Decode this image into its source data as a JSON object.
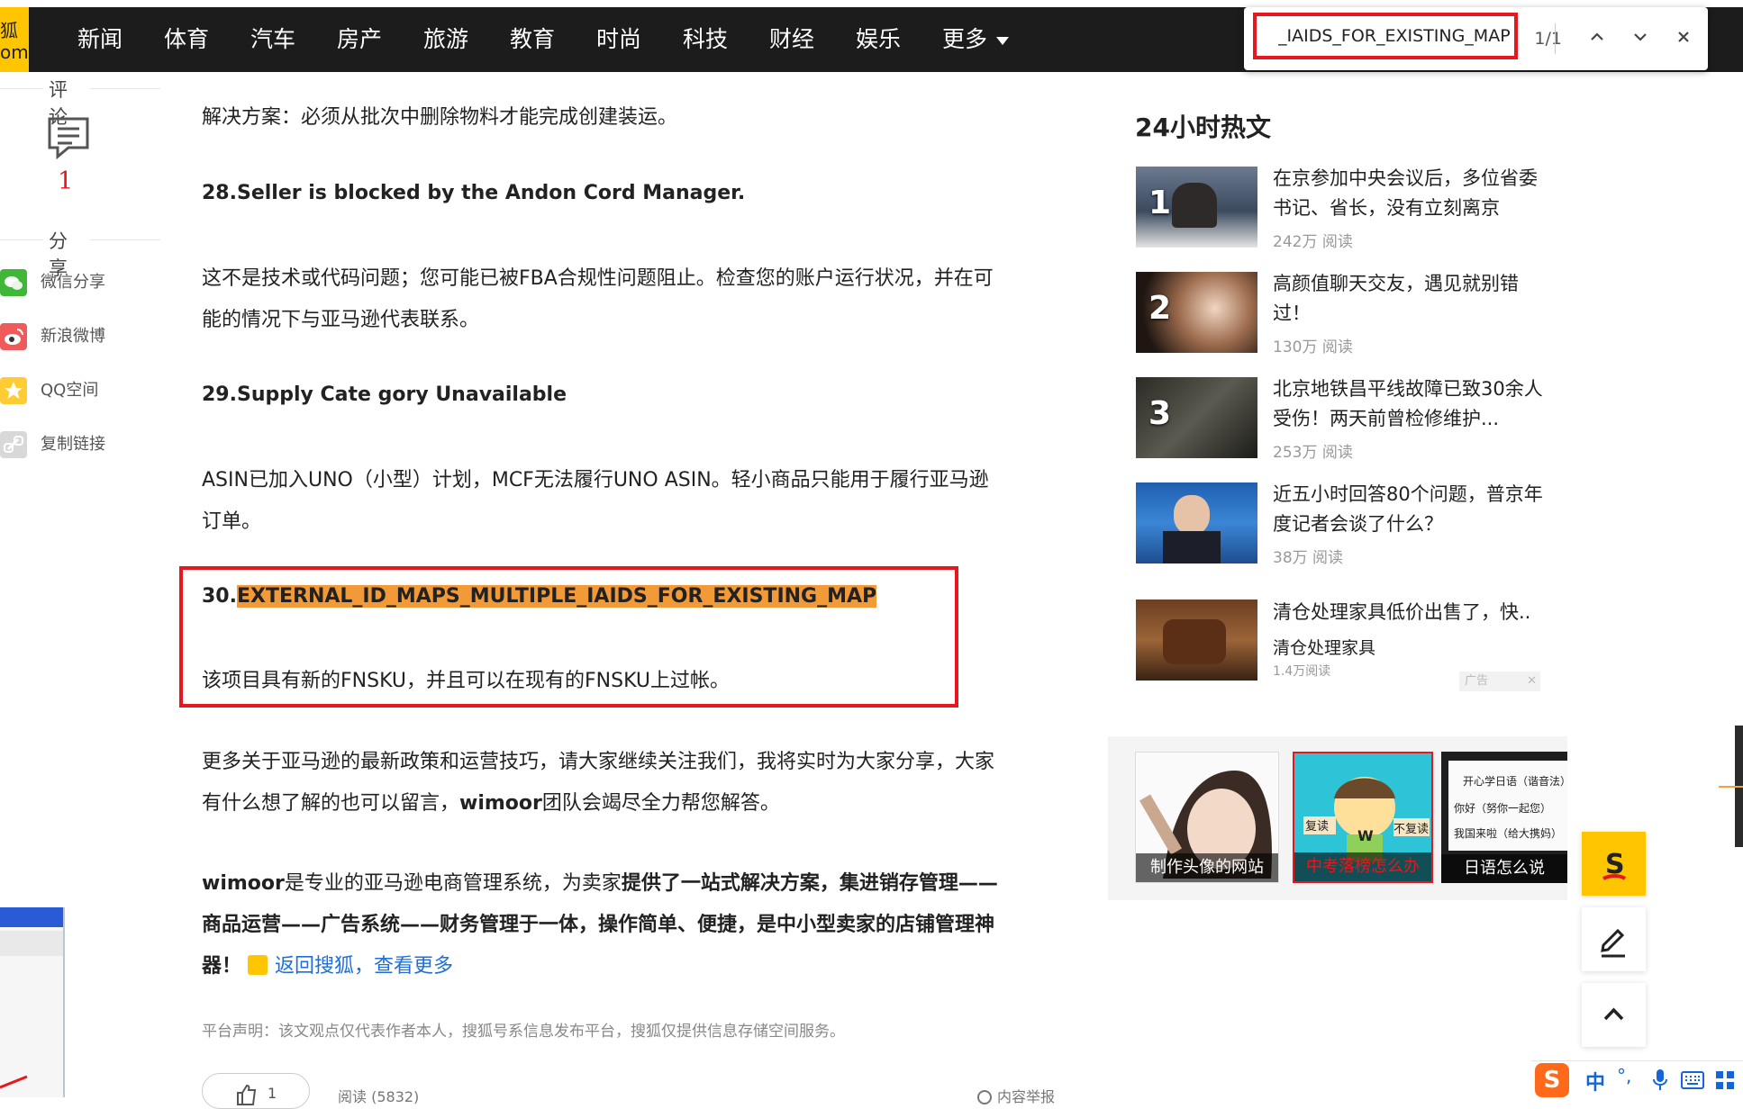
{
  "nav": {
    "logo": "狐\nom",
    "items": [
      "新闻",
      "体育",
      "汽车",
      "房产",
      "旅游",
      "教育",
      "时尚",
      "科技",
      "财经",
      "娱乐",
      "更多"
    ]
  },
  "find": {
    "query": "_IAIDS_FOR_EXISTING_MAP",
    "count": "1/1"
  },
  "sidebar": {
    "comment_label": "评论",
    "comment_count": "1",
    "share_label": "分享",
    "share_items": [
      "微信分享",
      "新浪微博",
      "QQ空间",
      "复制链接"
    ]
  },
  "article": {
    "p0": "解决方案：必须从批次中删除物料才能完成创建装运。",
    "h28": "28.Seller is blocked by the Andon Cord Manager.",
    "p28a": "这不是技术或代码问题；您可能已被FBA合规性问题阻止。检查您的账户运行状况，并在可",
    "p28b": "能的情况下与亚马逊代表联系。",
    "h29": "29.Supply Cate gory Unavailable",
    "p29a": "ASIN已加入UNO（小型）计划，MCF无法履行UNO ASIN。轻小商品只能用于履行亚马逊",
    "p29b": "订单。",
    "h30_prefix": "30.",
    "h30_highlight": "EXTERNAL_ID_MAPS_MULTIPLE_IAIDS_FOR_EXISTING_MAP",
    "p30": "该项目具有新的FNSKU，并且可以在现有的FNSKU上过帐。",
    "more_a": "更多关于亚马逊的最新政策和运营技巧，请大家继续关注我们，我将实时为大家分享，大家",
    "more_b_pre": "有什么想了解的也可以留言，",
    "more_b_bold": "wimoor",
    "more_b_post": "团队会竭尽全力帮您解答。",
    "wim_a_pre": "wimoor",
    "wim_a_mid": "是专业的亚马逊电商管理系统，为卖家",
    "wim_a_bold": "提供了一站式解决方案，集进销存管理——",
    "wim_b": "商品运营——广告系统——财务管理于一体，操作简单、便捷，是中小型卖家的店铺管理神",
    "wim_c": "器！",
    "back_link": "返回搜狐，查看更多",
    "note": "平台声明：该文观点仅代表作者本人，搜狐号系信息发布平台，搜狐仅提供信息存储空间服务。",
    "like": "1",
    "read": "阅读 (5832)",
    "report": "内容举报"
  },
  "hot": {
    "title": "24小时热文",
    "items": [
      {
        "num": "1",
        "text": "在京参加中央会议后，多位省委书记、省长，没有立刻离京",
        "read": "242万 阅读"
      },
      {
        "num": "2",
        "text": "高颜值聊天交友，遇见就别错过！",
        "read": "130万 阅读"
      },
      {
        "num": "3",
        "text": "北京地铁昌平线故障已致30余人受伤！两天前曾检修维护...",
        "read": "253万 阅读"
      },
      {
        "num": "",
        "text": "近五小时回答80个问题，普京年度记者会谈了什么？",
        "read": "38万 阅读"
      },
      {
        "num": "",
        "text": "清仓处理家具低价出售了，快..",
        "sub": "清仓处理家具",
        "read": "1.4万阅读"
      }
    ],
    "ad_tag": "广告"
  },
  "ads": [
    {
      "caption": "制作头像的网站"
    },
    {
      "caption": "中考落榜怎么办",
      "labels": [
        "复读",
        "W",
        "不复读"
      ]
    },
    {
      "caption": "日语怎么说",
      "lines": [
        "开心学日语（谐音法）",
        "你好（努你一起您）",
        "我国来啦（给大携妈）"
      ]
    }
  ],
  "ime": {
    "lang": "中",
    "punct": "°,"
  }
}
